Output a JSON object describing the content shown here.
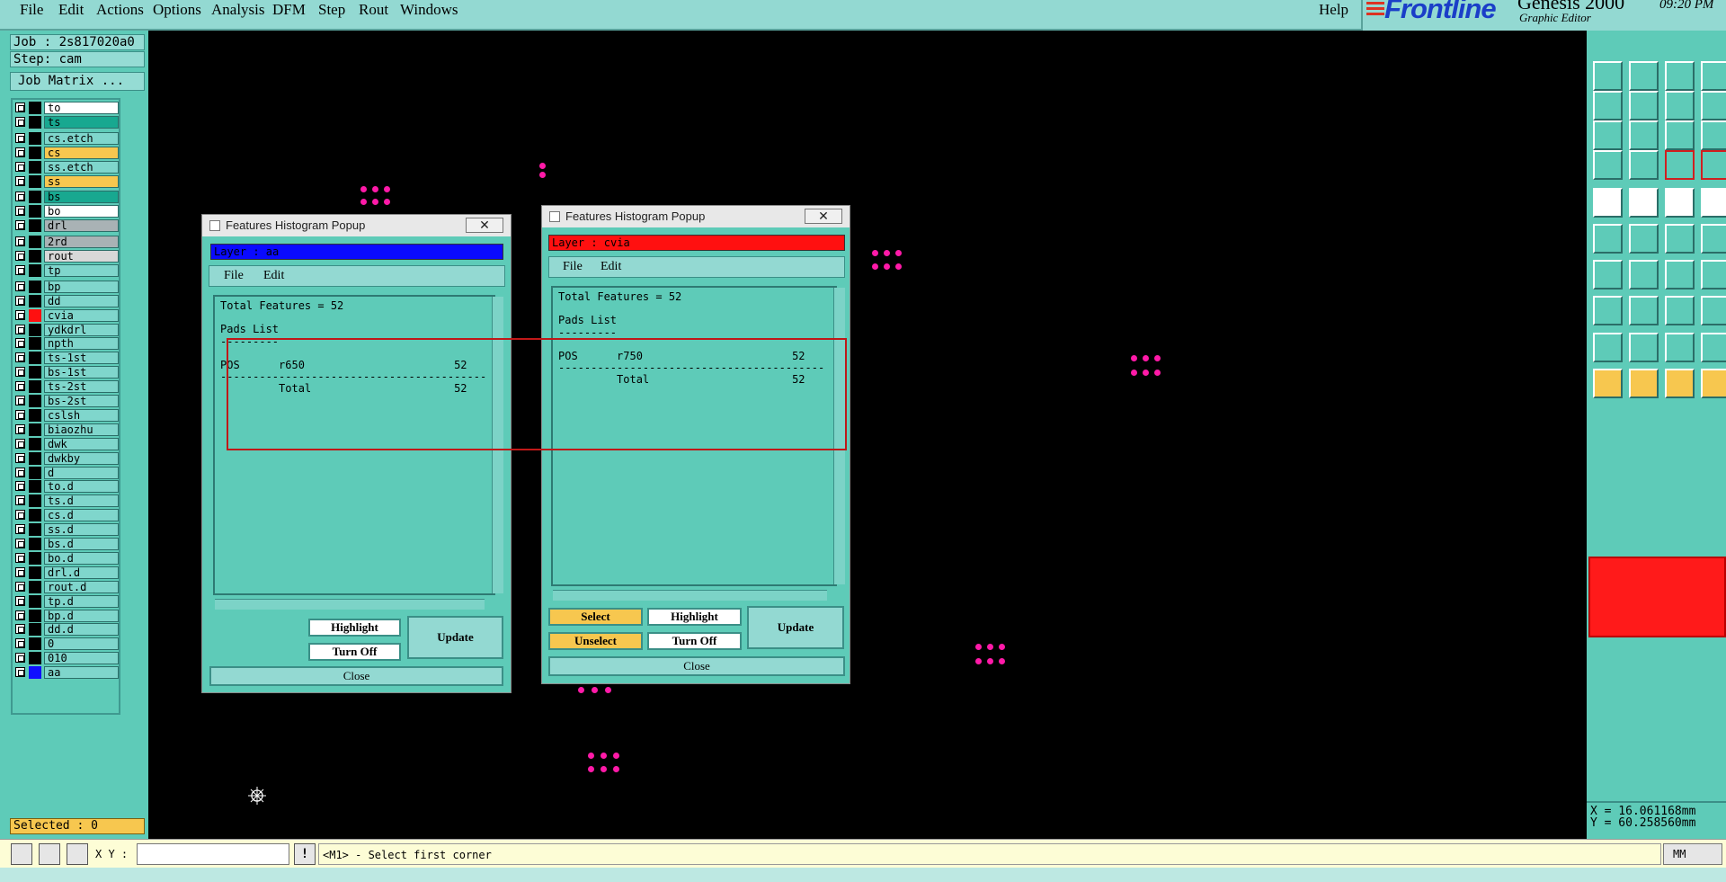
{
  "menubar": {
    "items": [
      "File",
      "Edit",
      "Actions",
      "Options",
      "Analysis",
      "DFM",
      "Step",
      "Rout",
      "Windows"
    ],
    "help": "Help"
  },
  "logo": {
    "brand": "Frontline",
    "product": "Genesis 2000",
    "subtitle": "Graphic Editor",
    "time": "09:20 PM"
  },
  "job": {
    "job_label": "Job : 2s817020a0",
    "step_label": "Step: cam",
    "matrix_button": "Job Matrix ..."
  },
  "layers": [
    {
      "name": "to",
      "color": "#ffffff"
    },
    {
      "name": "ts",
      "color": "#18a890"
    },
    {
      "name": "cs.etch",
      "color": "#7fd6cc"
    },
    {
      "name": "cs",
      "color": "#f7c74f"
    },
    {
      "name": "ss.etch",
      "color": "#7fd6cc"
    },
    {
      "name": "ss",
      "color": "#f7c74f"
    },
    {
      "name": "bs",
      "color": "#18a890"
    },
    {
      "name": "bo",
      "color": "#ffffff"
    },
    {
      "name": "drl",
      "color": "#a9b2b5"
    },
    {
      "name": "2rd",
      "color": "#a9b2b5"
    },
    {
      "name": "rout",
      "color": "#d8d8d8"
    },
    {
      "name": "tp",
      "color": "#7fd6cc"
    },
    {
      "name": "bp",
      "color": "#7fd6cc"
    },
    {
      "name": "dd",
      "color": "#7fd6cc"
    },
    {
      "name": "cvia",
      "color": "#7fd6cc",
      "active": true
    },
    {
      "name": "ydkdrl",
      "color": "#7fd6cc"
    },
    {
      "name": "npth",
      "color": "#7fd6cc"
    },
    {
      "name": "ts-1st",
      "color": "#7fd6cc"
    },
    {
      "name": "bs-1st",
      "color": "#7fd6cc"
    },
    {
      "name": "ts-2st",
      "color": "#7fd6cc"
    },
    {
      "name": "bs-2st",
      "color": "#7fd6cc"
    },
    {
      "name": "cslsh",
      "color": "#7fd6cc"
    },
    {
      "name": "biaozhu",
      "color": "#7fd6cc"
    },
    {
      "name": "dwk",
      "color": "#7fd6cc"
    },
    {
      "name": "dwkby",
      "color": "#7fd6cc"
    },
    {
      "name": "d",
      "color": "#7fd6cc"
    },
    {
      "name": "to.d",
      "color": "#7fd6cc"
    },
    {
      "name": "ts.d",
      "color": "#7fd6cc"
    },
    {
      "name": "cs.d",
      "color": "#7fd6cc"
    },
    {
      "name": "ss.d",
      "color": "#7fd6cc"
    },
    {
      "name": "bs.d",
      "color": "#7fd6cc"
    },
    {
      "name": "bo.d",
      "color": "#7fd6cc"
    },
    {
      "name": "drl.d",
      "color": "#7fd6cc"
    },
    {
      "name": "rout.d",
      "color": "#7fd6cc"
    },
    {
      "name": "tp.d",
      "color": "#7fd6cc"
    },
    {
      "name": "bp.d",
      "color": "#7fd6cc"
    },
    {
      "name": "dd.d",
      "color": "#7fd6cc"
    },
    {
      "name": "0",
      "color": "#7fd6cc"
    },
    {
      "name": "010",
      "color": "#7fd6cc"
    },
    {
      "name": "aa",
      "color": "#7fd6cc",
      "swatch": "#1010ff"
    }
  ],
  "selected": "Selected : 0",
  "popup_left": {
    "title": "Features Histogram Popup",
    "close_x": "✕",
    "layer": "Layer :  aa",
    "layer_color": "#0a0aff",
    "menu": [
      "File",
      "Edit"
    ],
    "lines": [
      "Total Features = 52",
      "",
      "Pads List",
      "---------",
      "",
      "POS      r650                       52",
      "-----------------------------------------",
      "         Total                      52"
    ],
    "buttons": {
      "highlight": "Highlight",
      "turnoff": "Turn Off",
      "update": "Update",
      "close": "Close"
    }
  },
  "popup_right": {
    "title": "Features Histogram Popup",
    "close_x": "✕",
    "layer": "Layer :  cvia",
    "layer_color": "#ff1010",
    "menu": [
      "File",
      "Edit"
    ],
    "lines": [
      "Total Features = 52",
      "",
      "Pads List",
      "---------",
      "",
      "POS      r750                       52",
      "-----------------------------------------",
      "         Total                      52"
    ],
    "buttons": {
      "select": "Select",
      "unselect": "Unselect",
      "highlight": "Highlight",
      "turnoff": "Turn Off",
      "update": "Update",
      "close": "Close"
    }
  },
  "coords": {
    "x": "X = 16.061168mm",
    "y": "Y = 60.258560mm"
  },
  "status": {
    "xy_label": "X Y :",
    "xy_value": "",
    "bang": "!",
    "prompt": "<M1> - Select first corner",
    "units": "MM"
  },
  "colors": {
    "panel": "#5ecbb8",
    "menubar": "#93d9d2",
    "pad": "#ff1aa8",
    "highlight": "#f7c74f"
  }
}
